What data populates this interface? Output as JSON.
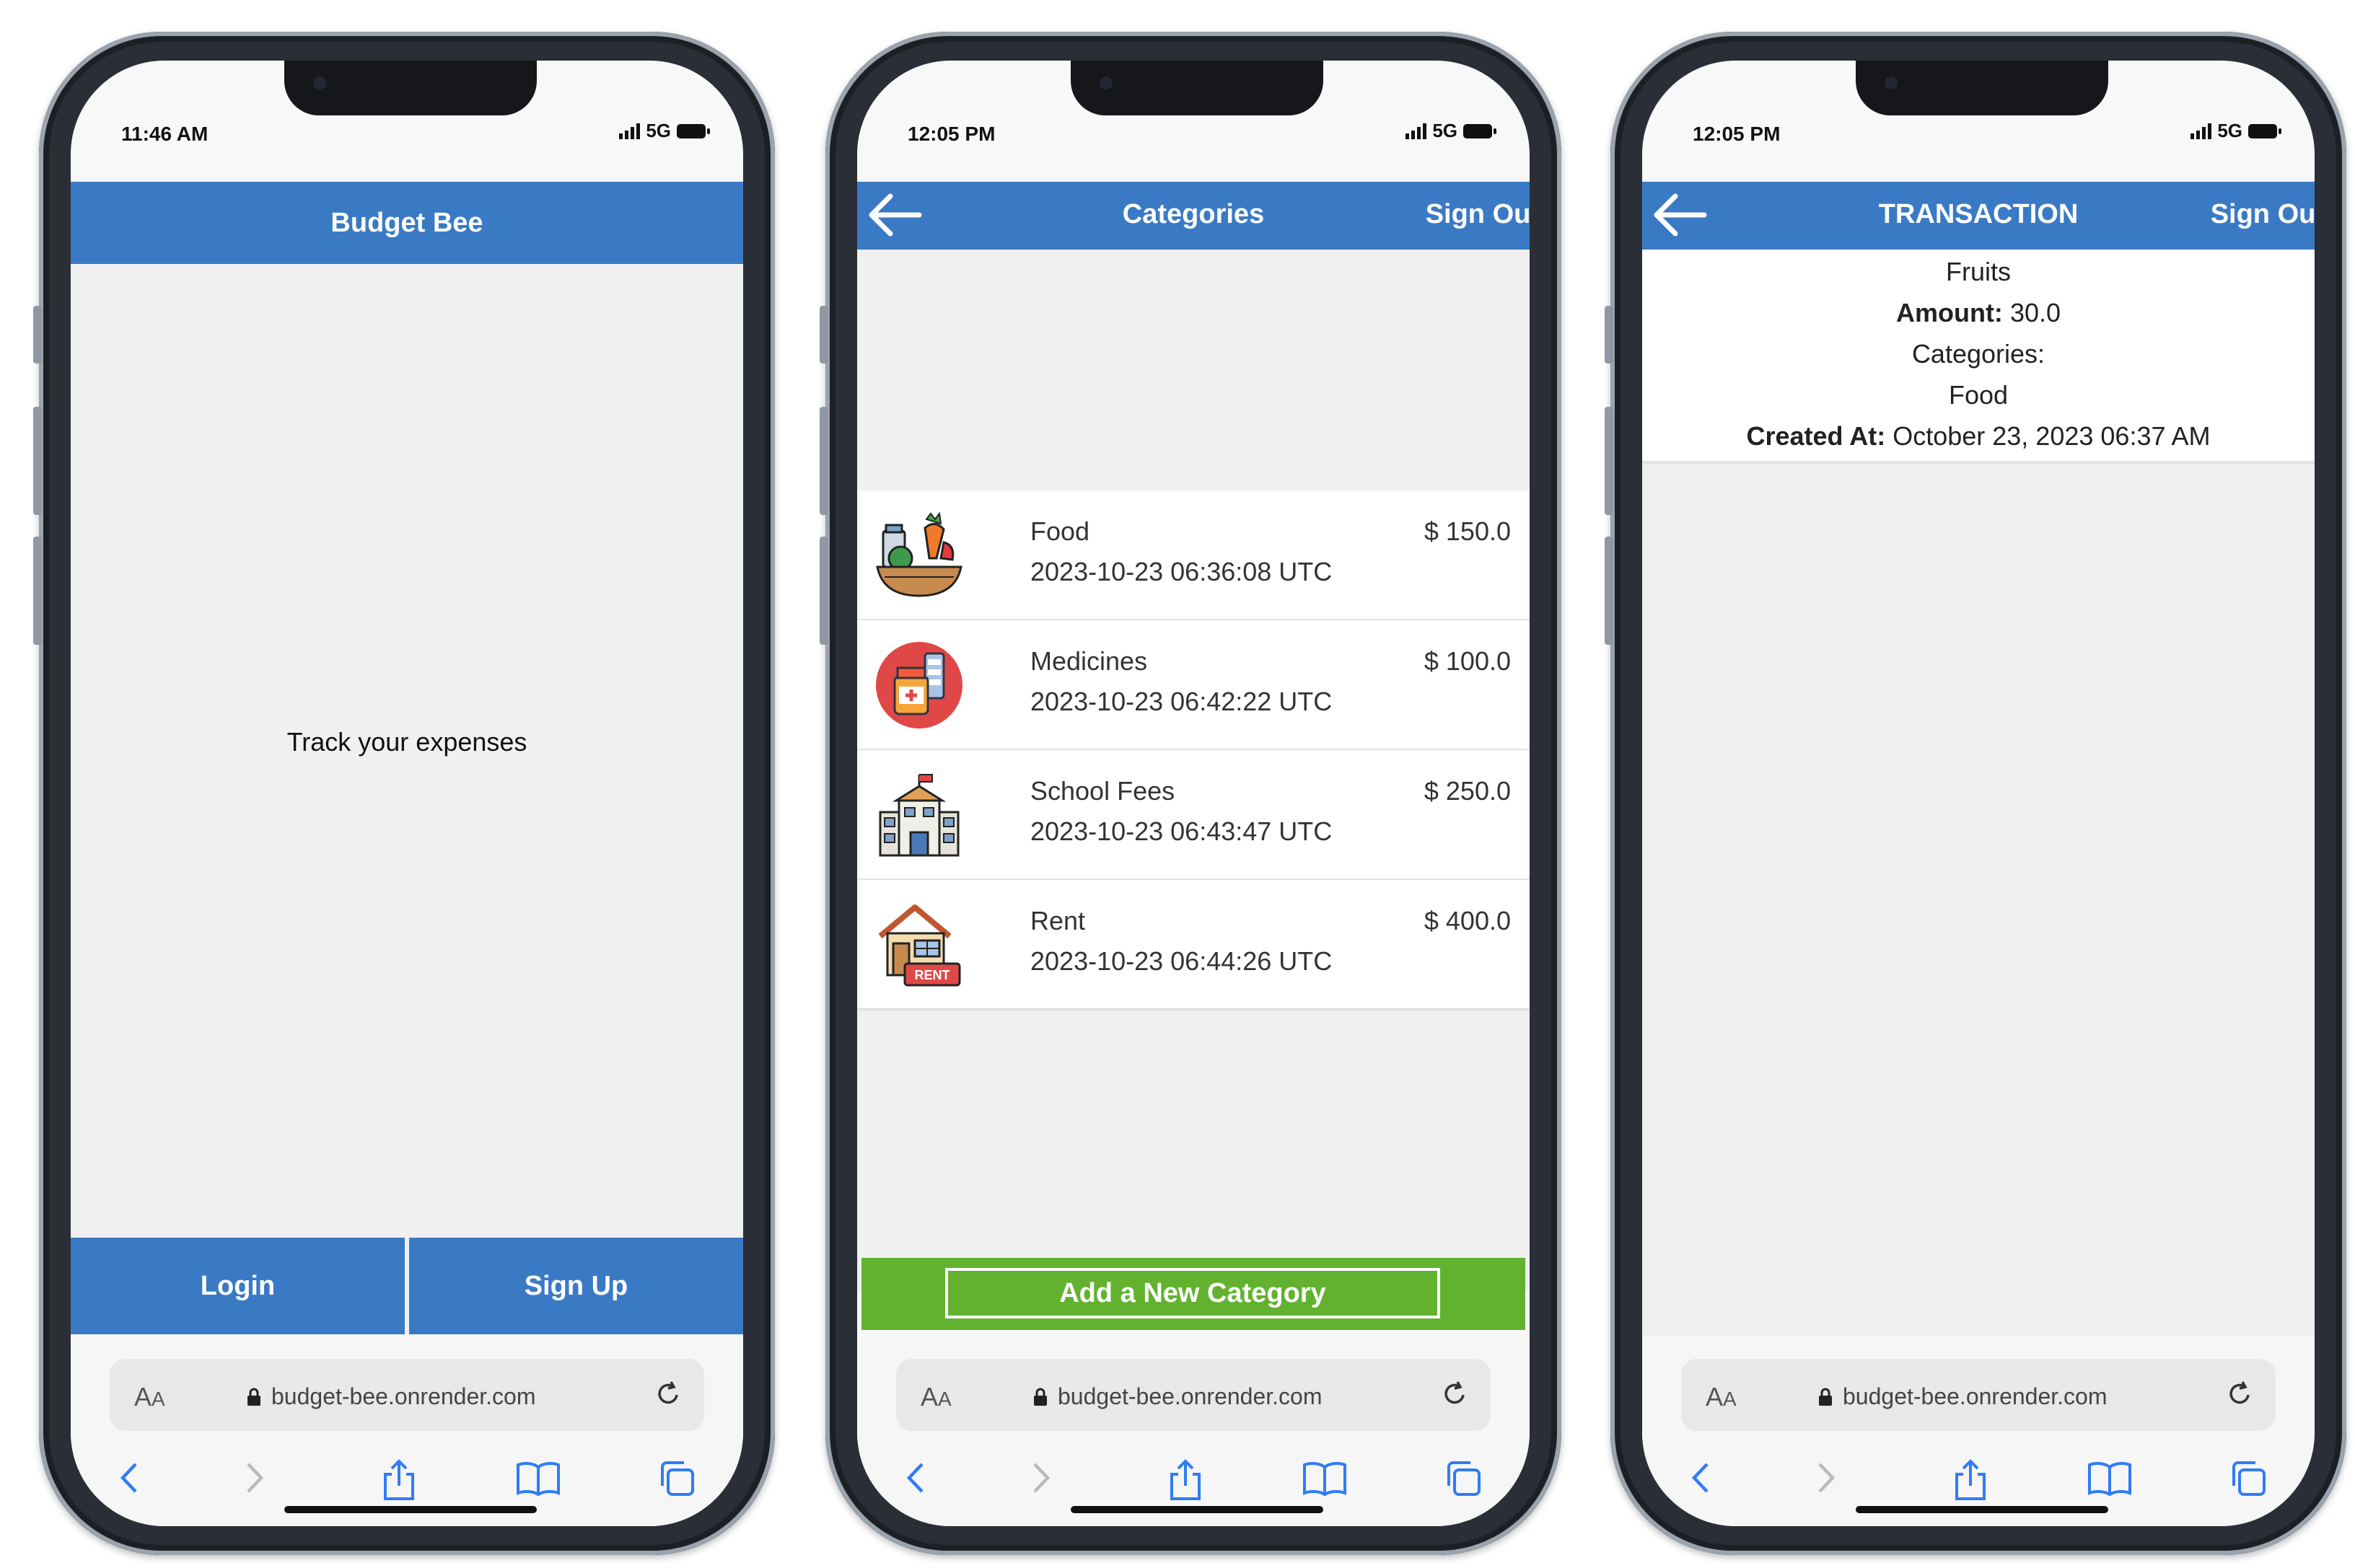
{
  "phone1": {
    "status": {
      "time": "11:46 AM",
      "network": "5G"
    },
    "header_title": "Budget Bee",
    "tagline": "Track your expenses",
    "login_label": "Login",
    "signup_label": "Sign Up",
    "url": "budget-bee.onrender.com"
  },
  "phone2": {
    "status": {
      "time": "12:05 PM",
      "network": "5G"
    },
    "header_title": "Categories",
    "signout_label": "Sign Out",
    "categories": [
      {
        "name": "Food",
        "date": "2023-10-23 06:36:08 UTC",
        "amount": "$ 150.0",
        "icon": "food-basket-icon"
      },
      {
        "name": "Medicines",
        "date": "2023-10-23 06:42:22 UTC",
        "amount": "$ 100.0",
        "icon": "medicine-icon"
      },
      {
        "name": "School Fees",
        "date": "2023-10-23 06:43:47 UTC",
        "amount": "$ 250.0",
        "icon": "school-icon"
      },
      {
        "name": "Rent",
        "date": "2023-10-23 06:44:26 UTC",
        "amount": "$ 400.0",
        "icon": "rent-house-icon"
      }
    ],
    "add_button_label": "Add a New Category",
    "url": "budget-bee.onrender.com"
  },
  "phone3": {
    "status": {
      "time": "12:05 PM",
      "network": "5G"
    },
    "header_title": "TRANSACTION",
    "signout_label": "Sign Out",
    "transaction": {
      "name": "Fruits",
      "amount_label": "Amount:",
      "amount_value": "30.0",
      "categories_label": "Categories:",
      "category": "Food",
      "created_label": "Created At:",
      "created_value": "October 23, 2023 06:37 AM"
    },
    "url": "budget-bee.onrender.com"
  },
  "safari": {
    "aa_label": "AA"
  },
  "colors": {
    "header_blue": "#3a7ac5",
    "add_green": "#62b22f",
    "content_bg": "#eff0ef"
  }
}
